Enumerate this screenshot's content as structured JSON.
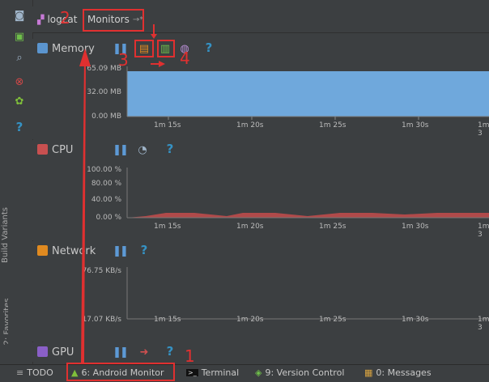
{
  "tabs": {
    "logcat": "logcat",
    "monitors": "Monitors",
    "monitors_pin": "→*"
  },
  "side_labels": {
    "build_variants": "Build Variants",
    "favorites": "2: Favorites"
  },
  "memory": {
    "title": "Memory",
    "yticks": [
      "65.09 MB",
      "32.00 MB",
      "0.00 MB"
    ],
    "xticks": [
      "1m 15s",
      "1m 20s",
      "1m 25s",
      "1m 30s",
      "1m 3"
    ]
  },
  "cpu": {
    "title": "CPU",
    "yticks": [
      "100.00 %",
      "80.00 %",
      "40.00 %",
      "0.00 %"
    ],
    "xticks": [
      "1m 15s",
      "1m 20s",
      "1m 25s",
      "1m 30s",
      "1m 3"
    ]
  },
  "network": {
    "title": "Network",
    "yticks": [
      "76.75 KB/s",
      "17.07 KB/s"
    ],
    "xticks": [
      "1m 15s",
      "1m 20s",
      "1m 25s",
      "1m 30s",
      "1m 3"
    ]
  },
  "gpu": {
    "title": "GPU"
  },
  "bottom": {
    "todo": "TODO",
    "android_monitor": "6: Android Monitor",
    "terminal": "Terminal",
    "version_control": "9: Version Control",
    "messages": "0: Messages"
  },
  "annotations": [
    "1",
    "2",
    "3",
    "4"
  ],
  "colors": {
    "memory_fill": "#6fa8dc",
    "cpu_fill": "#b04a4a",
    "highlight": "#e03030",
    "accent": "#3592c4"
  }
}
